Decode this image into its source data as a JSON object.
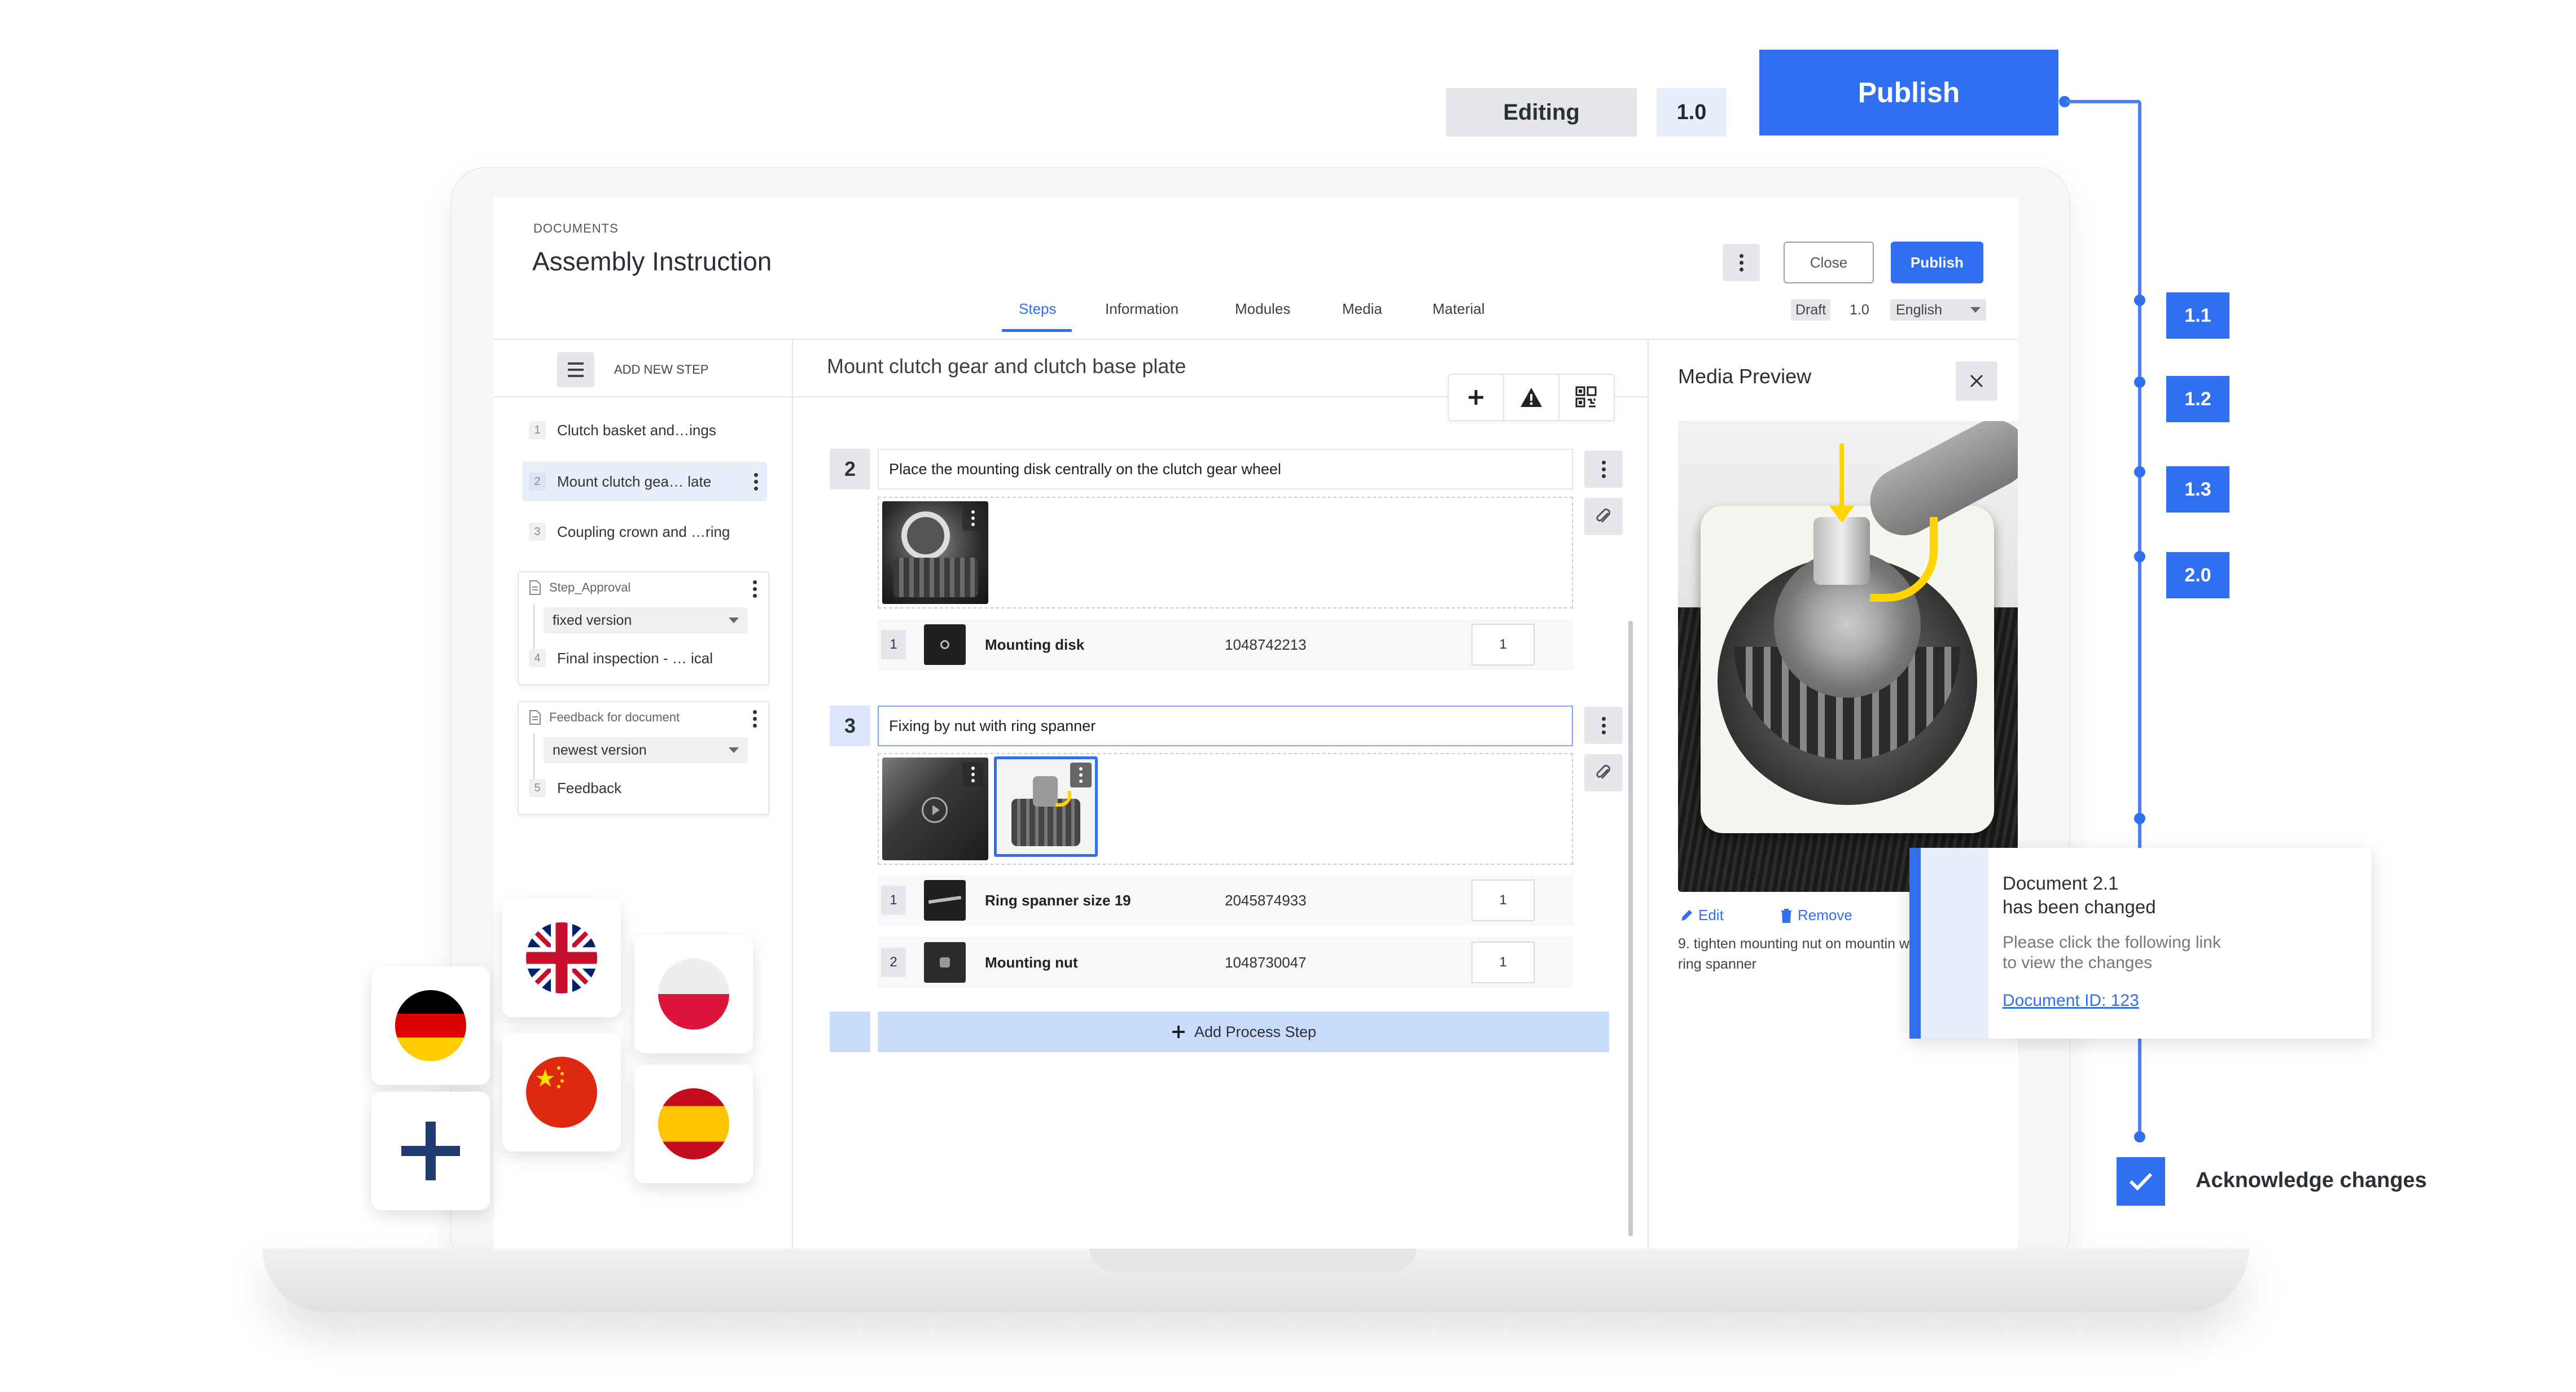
{
  "version_bar": {
    "editing_label": "Editing",
    "version_label": "1.0",
    "publish_label": "Publish"
  },
  "timeline": {
    "versions": [
      "1.1",
      "1.2",
      "1.3",
      "2.0"
    ]
  },
  "header": {
    "section_label": "DOCUMENTS",
    "title": "Assembly Instruction",
    "close_label": "Close",
    "publish_label": "Publish",
    "tabs": [
      "Steps",
      "Information",
      "Modules",
      "Media",
      "Material"
    ],
    "active_tab": "Steps",
    "status": "Draft",
    "version": "1.0",
    "language": "English"
  },
  "steps_panel": {
    "add_new_step_label": "ADD NEW STEP",
    "steps": [
      {
        "num": "1",
        "label": "Clutch basket and…ings"
      },
      {
        "num": "2",
        "label": "Mount clutch gea… late"
      },
      {
        "num": "3",
        "label": "Coupling crown and …ring"
      }
    ],
    "groups": [
      {
        "title": "Step_Approval",
        "select_value": "fixed version",
        "step": {
          "num": "4",
          "label": "Final inspection - … ical"
        }
      },
      {
        "title": "Feedback for document",
        "select_value": "newest version",
        "step": {
          "num": "5",
          "label": "Feedback"
        }
      }
    ]
  },
  "editor": {
    "title": "Mount clutch gear and clutch base plate",
    "process_steps": [
      {
        "num": "2",
        "text": "Place the mounting disk centrally on the clutch gear wheel",
        "materials": [
          {
            "idx": "1",
            "name": "Mounting disk",
            "number": "1048742213",
            "qty": "1"
          }
        ]
      },
      {
        "num": "3",
        "text": "Fixing by nut with ring spanner",
        "materials": [
          {
            "idx": "1",
            "name": "Ring spanner size 19",
            "number": "2045874933",
            "qty": "1"
          },
          {
            "idx": "2",
            "name": "Mounting nut",
            "number": "1048730047",
            "qty": "1"
          }
        ]
      }
    ],
    "add_process_step_label": "Add Process Step"
  },
  "media_preview": {
    "title": "Media Preview",
    "edit_label": "Edit",
    "remove_label": "Remove",
    "caption": "9. tighten mounting nut on mountin with ring spanner"
  },
  "notification": {
    "title_line1": "Document 2.1",
    "title_line2": "has been changed",
    "body_line1": "Please click the following link",
    "body_line2": "to view the changes",
    "link": "Document ID: 123"
  },
  "acknowledge_label": "Acknowledge changes",
  "colors": {
    "accent": "#2f6ff0",
    "accent_light": "#e8effb",
    "neutral_button": "#e6e7ea"
  },
  "icons": [
    "kebab-menu-icon",
    "hamburger-icon",
    "plus-icon",
    "warning-icon",
    "qr-code-icon",
    "paperclip-icon",
    "close-icon",
    "pencil-icon",
    "trash-icon",
    "check-icon",
    "play-icon"
  ],
  "flags": [
    "germany",
    "united-kingdom",
    "poland",
    "china",
    "spain"
  ]
}
